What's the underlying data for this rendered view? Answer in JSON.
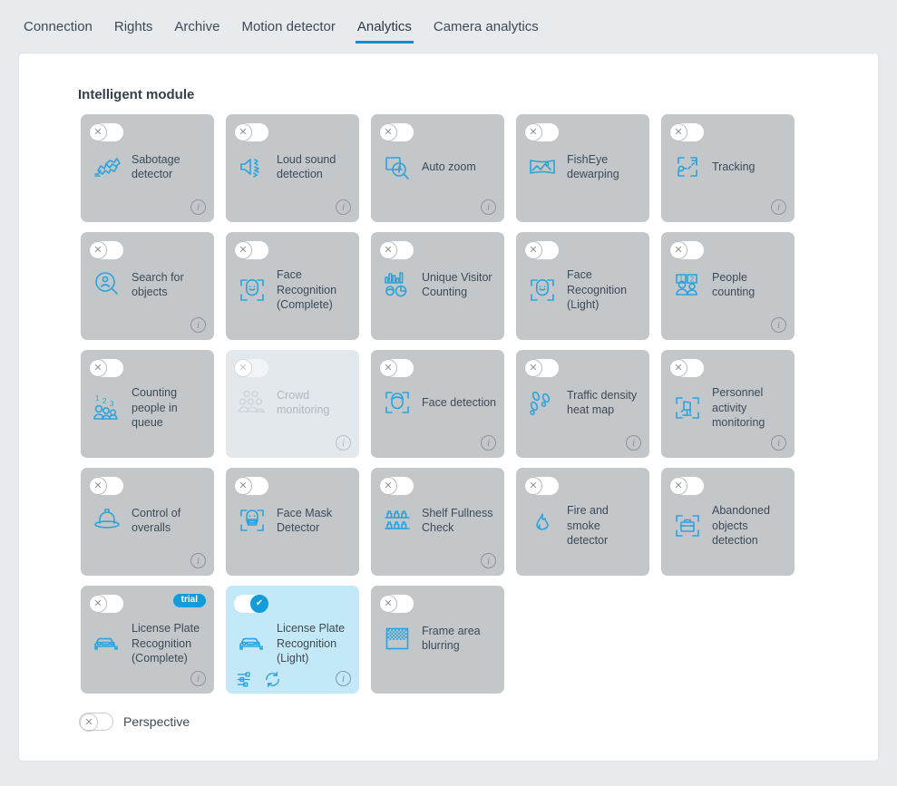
{
  "tabs": [
    {
      "label": "Connection",
      "active": false
    },
    {
      "label": "Rights",
      "active": false
    },
    {
      "label": "Archive",
      "active": false
    },
    {
      "label": "Motion detector",
      "active": false
    },
    {
      "label": "Analytics",
      "active": true
    },
    {
      "label": "Camera analytics",
      "active": false
    }
  ],
  "panel": {
    "title": "Intelligent module"
  },
  "colors": {
    "accent": "#0c8fce",
    "toggle_on": "#129cd8",
    "card_bg": "#c4c7ca",
    "card_bg_active": "#c3e8f7",
    "card_bg_disabled": "#e3e8ec",
    "page_bg": "#e8ebee",
    "panel_bg": "#ffffff",
    "icon_blue": "#2aa3dd",
    "text": "#3d4a55"
  },
  "modules": [
    {
      "label": "Sabotage detector",
      "icon": "sabotage-detector-icon",
      "state": "off",
      "info": true,
      "badge": null,
      "disabled": false
    },
    {
      "label": "Loud sound detection",
      "icon": "loud-sound-icon",
      "state": "off",
      "info": true,
      "badge": null,
      "disabled": false
    },
    {
      "label": "Auto zoom",
      "icon": "auto-zoom-icon",
      "state": "off",
      "info": true,
      "badge": null,
      "disabled": false
    },
    {
      "label": "FishEye dewarping",
      "icon": "fisheye-dewarping-icon",
      "state": "off",
      "info": false,
      "badge": null,
      "disabled": false
    },
    {
      "label": "Tracking",
      "icon": "tracking-icon",
      "state": "off",
      "info": true,
      "badge": null,
      "disabled": false
    },
    {
      "label": "Search for objects",
      "icon": "search-objects-icon",
      "state": "off",
      "info": true,
      "badge": null,
      "disabled": false
    },
    {
      "label": "Face Recognition (Complete)",
      "icon": "face-recognition-icon",
      "state": "off",
      "info": false,
      "badge": null,
      "disabled": false
    },
    {
      "label": "Unique Visitor Counting",
      "icon": "unique-visitor-counting-icon",
      "state": "off",
      "info": false,
      "badge": null,
      "disabled": false
    },
    {
      "label": "Face Recognition (Light)",
      "icon": "face-recognition-icon",
      "state": "off",
      "info": false,
      "badge": null,
      "disabled": false
    },
    {
      "label": "People counting",
      "icon": "people-counting-icon",
      "state": "off",
      "info": true,
      "badge": null,
      "disabled": false
    },
    {
      "label": "Counting people in queue",
      "icon": "counting-people-queue-icon",
      "state": "off",
      "info": false,
      "badge": null,
      "disabled": false
    },
    {
      "label": "Crowd monitoring",
      "icon": "crowd-monitoring-icon",
      "state": "off",
      "info": true,
      "badge": null,
      "disabled": true
    },
    {
      "label": "Face detection",
      "icon": "face-detection-icon",
      "state": "off",
      "info": true,
      "badge": null,
      "disabled": false
    },
    {
      "label": "Traffic density heat map",
      "icon": "traffic-heatmap-icon",
      "state": "off",
      "info": true,
      "badge": null,
      "disabled": false
    },
    {
      "label": "Personnel activity monitoring",
      "icon": "personnel-activity-icon",
      "state": "off",
      "info": true,
      "badge": null,
      "disabled": false
    },
    {
      "label": "Control of overalls",
      "icon": "hard-hat-icon",
      "state": "off",
      "info": true,
      "badge": null,
      "disabled": false
    },
    {
      "label": "Face Mask Detector",
      "icon": "face-mask-icon",
      "state": "off",
      "info": false,
      "badge": null,
      "disabled": false
    },
    {
      "label": "Shelf Fullness Check",
      "icon": "shelf-fullness-icon",
      "state": "off",
      "info": true,
      "badge": null,
      "disabled": false
    },
    {
      "label": "Fire and smoke detector",
      "icon": "flame-icon",
      "state": "off",
      "info": false,
      "badge": null,
      "disabled": false
    },
    {
      "label": "Abandoned objects detection",
      "icon": "abandoned-object-icon",
      "state": "off",
      "info": false,
      "badge": null,
      "disabled": false
    },
    {
      "label": "License Plate Recognition (Complete)",
      "icon": "license-plate-icon",
      "state": "off",
      "info": true,
      "badge": "trial",
      "disabled": false
    },
    {
      "label": "License Plate Recognition (Light)",
      "icon": "license-plate-icon",
      "state": "on",
      "info": true,
      "badge": null,
      "disabled": false,
      "actions": [
        "settings-sliders-icon",
        "refresh-icon"
      ]
    },
    {
      "label": "Frame area blurring",
      "icon": "frame-blurring-icon",
      "state": "off",
      "info": false,
      "badge": null,
      "disabled": false
    }
  ],
  "perspective": {
    "label": "Perspective",
    "state": "off"
  },
  "toggle_glyphs": {
    "off": "✕",
    "on": "✔"
  }
}
